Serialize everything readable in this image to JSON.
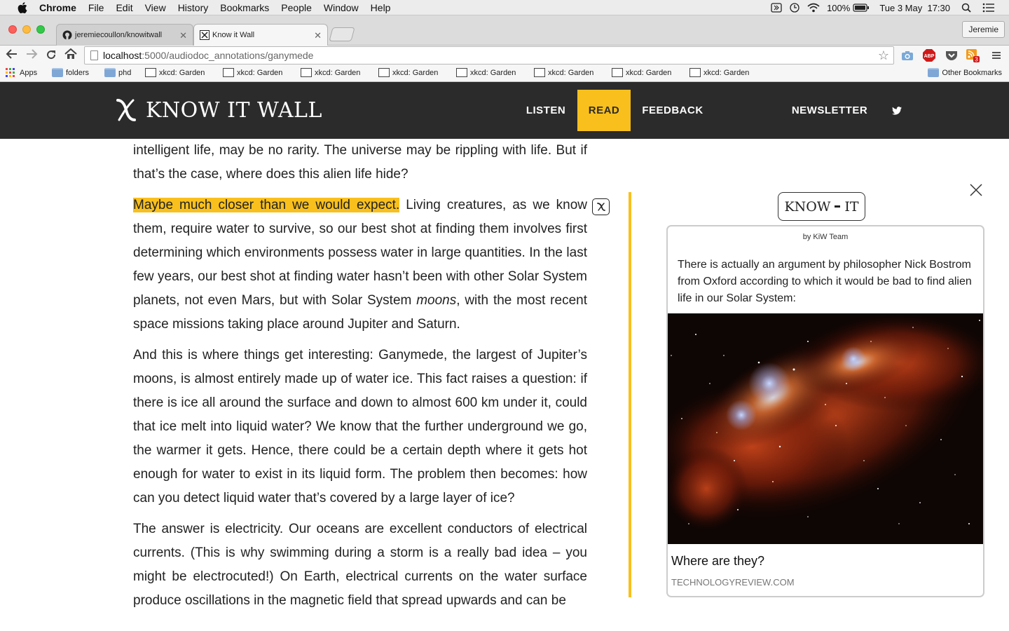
{
  "os_menu": {
    "app": "Chrome",
    "items": [
      "File",
      "Edit",
      "View",
      "History",
      "Bookmarks",
      "People",
      "Window",
      "Help"
    ],
    "battery": "100%",
    "datetime": "Tue 3 May  17:30"
  },
  "browser": {
    "tabs": [
      {
        "title": "jeremiecoullon/knowitwall"
      },
      {
        "title": "Know it Wall"
      }
    ],
    "user": "Jeremie",
    "url_host": "localhost",
    "url_rest": ":5000/audiodoc_annotations/ganymede",
    "ext_badge": "3",
    "abp_label": "ABP",
    "bookmarks": [
      {
        "label": "Apps",
        "icon": "apps-grid-icon"
      },
      {
        "label": "folders",
        "icon": "folder-icon"
      },
      {
        "label": "phd",
        "icon": "folder-icon"
      },
      {
        "label": "xkcd: Garden",
        "icon": "xkcd-icon"
      },
      {
        "label": "xkcd: Garden",
        "icon": "xkcd-icon"
      },
      {
        "label": "xkcd: Garden",
        "icon": "xkcd-icon"
      },
      {
        "label": "xkcd: Garden",
        "icon": "xkcd-icon"
      },
      {
        "label": "xkcd: Garden",
        "icon": "xkcd-icon"
      },
      {
        "label": "xkcd: Garden",
        "icon": "xkcd-icon"
      },
      {
        "label": "xkcd: Garden",
        "icon": "xkcd-icon"
      },
      {
        "label": "xkcd: Garden",
        "icon": "xkcd-icon"
      }
    ],
    "other_bookmarks": "Other Bookmarks"
  },
  "site": {
    "logo_text": "KNOW IT WALL",
    "nav": {
      "listen": "LISTEN",
      "read": "READ",
      "feedback": "FEEDBACK",
      "newsletter": "NEWSLETTER"
    },
    "accent": "#f9c01d",
    "header_bg": "#2b2b2b"
  },
  "article": {
    "p1": "intelligent life, may be no rarity. The universe may be rippling with life. But if that’s the case, where does this alien life hide?",
    "p2_highlight": "Maybe much closer than we would expect.",
    "p2_a": " Living creatures, as we know them, require water to survive, so our best shot at finding them involves first determining which environments possess water in large quantities. In the last few years, our best shot at finding water hasn’t been with other Solar System planets, not even Mars, but with Solar System ",
    "p2_em": "moons",
    "p2_b": ", with the most recent space missions taking place around Jupiter and Saturn.",
    "p3": "And this is where things get interesting: Ganymede, the largest of Jupiter’s moons, is almost entirely made up of water ice. This fact raises a question: if there is ice all around the surface and down to almost 600 km under it, could that ice melt into liquid water? We know that the further underground we go, the warmer it gets. Hence, there could be a certain depth where it gets hot enough for water to exist in its liquid form. The problem then becomes: how can you detect liquid water that’s covered by a large layer of ice?",
    "p4": "The answer is electricity. Our oceans are excellent conductors of electrical currents. (This is why swimming during a storm is a really bad idea – you might be electrocuted!) On Earth, electrical currents on the water surface produce oscillations in the magnetic field that spread upwards and can be"
  },
  "annotation": {
    "badge_left": "KNOW",
    "badge_right": "IT",
    "byline": "by KiW Team",
    "body": "There is actually an argument by philosopher Nick Bostrom from Oxford according to which it would be bad to find alien life in our Solar System:",
    "link_title": "Where are they?",
    "link_source": "TECHNOLOGYREVIEW.COM"
  }
}
